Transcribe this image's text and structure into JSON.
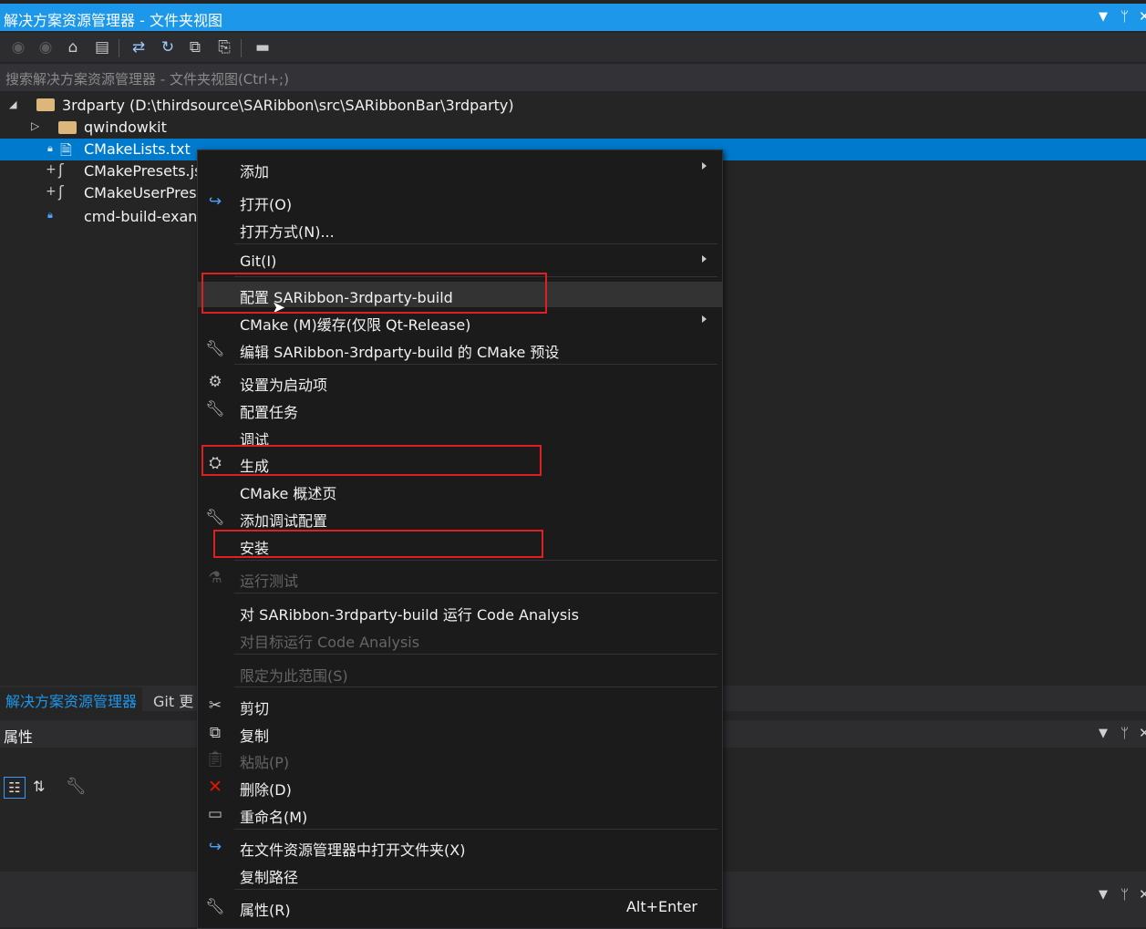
{
  "titlebar": {
    "title": "解决方案资源管理器 - 文件夹视图",
    "dropdown_icon": "triangle-down",
    "pin_icon": "pin",
    "close_icon": "close"
  },
  "toolbar": {
    "icons": [
      "back-icon",
      "forward-icon",
      "home-icon",
      "switch-views-icon",
      "sync-icon",
      "refresh-icon",
      "collapse-all-icon",
      "show-all-files-icon",
      "properties-icon"
    ]
  },
  "search": {
    "placeholder": "搜索解决方案资源管理器 - 文件夹视图(Ctrl+;)"
  },
  "tree": {
    "root": "3rdparty (D:\\thirdsource\\SARibbon\\src\\SARibbonBar\\3rdparty)",
    "items": [
      {
        "label": "qwindowkit",
        "type": "folder"
      },
      {
        "label": "CMakeLists.txt",
        "type": "file",
        "selected": true
      },
      {
        "label": "CMakePresets.js",
        "type": "json"
      },
      {
        "label": "CMakeUserPrese",
        "type": "json"
      },
      {
        "label": "cmd-build-exan",
        "type": "file"
      }
    ]
  },
  "bottom": {
    "tab_solution_explorer": "解决方案资源管理器",
    "tab_git": "Git 更",
    "properties_title": "属性"
  },
  "menu": {
    "add": "添加",
    "open": "打开(O)",
    "open_with": "打开方式(N)...",
    "git": "Git(I)",
    "configure": "配置 SARibbon-3rdparty-build",
    "cmake_cache": "CMake (M)缓存(仅限 Qt-Release)",
    "edit_preset": "编辑 SARibbon-3rdparty-build 的 CMake 预设",
    "set_startup": "设置为启动项",
    "configure_tasks": "配置任务",
    "debug": "调试",
    "build": "生成",
    "cmake_overview": "CMake 概述页",
    "add_debug_config": "添加调试配置",
    "install": "安装",
    "run_tests": "运行测试",
    "run_code_analysis": "对 SARibbon-3rdparty-build 运行 Code Analysis",
    "run_code_analysis_target": "对目标运行 Code Analysis",
    "scope_to_this": "限定为此范围(S)",
    "cut": "剪切",
    "copy": "复制",
    "paste": "粘贴(P)",
    "delete": "删除(D)",
    "rename": "重命名(M)",
    "open_in_explorer": "在文件资源管理器中打开文件夹(X)",
    "copy_path": "复制路径",
    "properties": "属性(R)",
    "properties_shortcut": "Alt+Enter"
  },
  "colors": {
    "accent": "#1c97ea",
    "selection": "#007acc",
    "highlight_box": "#e02020",
    "background": "#252526",
    "menu_background": "#1b1b1c"
  }
}
